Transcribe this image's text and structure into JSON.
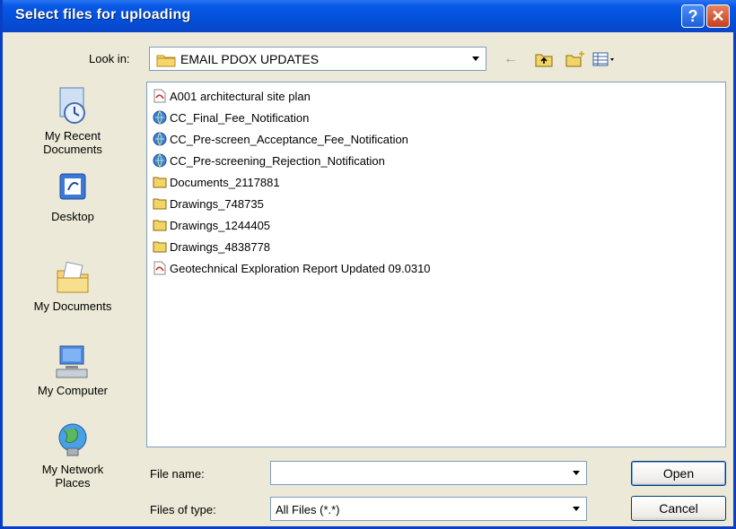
{
  "window": {
    "title": "Select files for uploading",
    "help_label": "?",
    "close_label": "✕"
  },
  "lookin": {
    "label": "Look in:",
    "value": "EMAIL PDOX UPDATES"
  },
  "toolbar": {
    "back_glyph": "←",
    "icons": [
      "back-icon",
      "up-folder-icon",
      "new-folder-icon",
      "view-menu-icon"
    ]
  },
  "places": [
    {
      "id": "recent",
      "label": "My Recent\nDocuments",
      "icon": "recent-documents-icon"
    },
    {
      "id": "desktop",
      "label": "Desktop",
      "icon": "desktop-icon"
    },
    {
      "id": "mydocs",
      "label": "My Documents",
      "icon": "my-documents-icon"
    },
    {
      "id": "mycomputer",
      "label": "My Computer",
      "icon": "my-computer-icon"
    },
    {
      "id": "network",
      "label": "My Network\nPlaces",
      "icon": "network-places-icon"
    }
  ],
  "files": [
    {
      "name": "A001 architectural site plan",
      "type": "pdf"
    },
    {
      "name": "CC_Final_Fee_Notification",
      "type": "web"
    },
    {
      "name": "CC_Pre-screen_Acceptance_Fee_Notification",
      "type": "web"
    },
    {
      "name": "CC_Pre-screening_Rejection_Notification",
      "type": "web"
    },
    {
      "name": "Documents_2117881",
      "type": "folder"
    },
    {
      "name": "Drawings_748735",
      "type": "folder"
    },
    {
      "name": "Drawings_1244405",
      "type": "folder"
    },
    {
      "name": "Drawings_4838778",
      "type": "folder"
    },
    {
      "name": "Geotechnical Exploration Report Updated 09.0310",
      "type": "pdf"
    }
  ],
  "filename": {
    "label": "File name:",
    "value": ""
  },
  "filetype": {
    "label": "Files of type:",
    "value": "All Files (*.*)"
  },
  "buttons": {
    "open": "Open",
    "cancel": "Cancel"
  }
}
